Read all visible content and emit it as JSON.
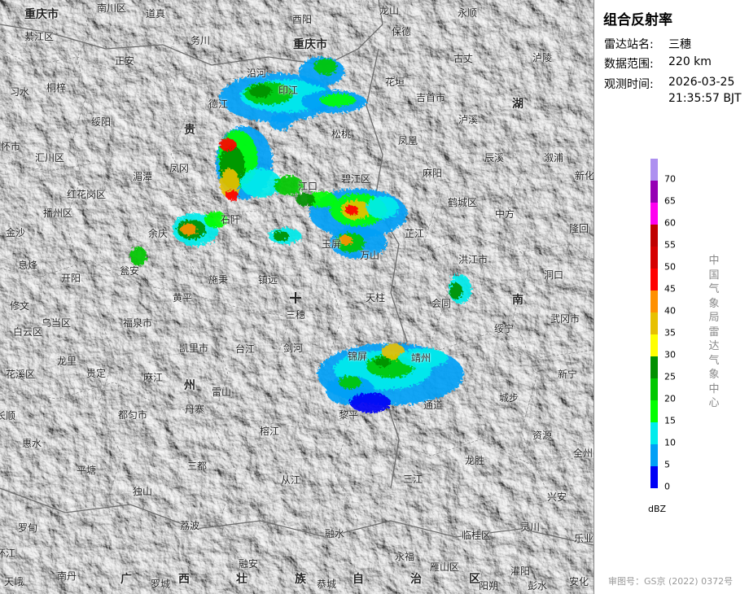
{
  "info": {
    "title": "组合反射率",
    "station_label": "雷达站名:",
    "station_value": "三穗",
    "range_label": "数据范围:",
    "range_value": "220 km",
    "time_label": "观测时间:",
    "time_date": "2026-03-25",
    "time_clock": "21:35:57 BJT"
  },
  "legend": {
    "unit": "dBZ",
    "ticks": [
      "0",
      "5",
      "10",
      "15",
      "20",
      "25",
      "30",
      "35",
      "40",
      "45",
      "50",
      "55",
      "60",
      "65",
      "70"
    ],
    "colors": [
      "#0000f6",
      "#01a0f6",
      "#00ecec",
      "#01ff00",
      "#00c800",
      "#019000",
      "#ffff00",
      "#e7c000",
      "#ff9000",
      "#ff0000",
      "#d60000",
      "#c00000",
      "#ff00f0",
      "#9600b4",
      "#ad90f0"
    ]
  },
  "org": "中国气象局雷达气象中心",
  "review": "审图号：GS京 (2022) 0372号",
  "regions": [
    {
      "t": "重庆市"
    },
    {
      "t": "重庆市"
    },
    {
      "t": "贵"
    },
    {
      "t": "州"
    },
    {
      "t": "湖"
    },
    {
      "t": "南"
    },
    {
      "t": "广"
    },
    {
      "t": "西"
    },
    {
      "t": "壮"
    },
    {
      "t": "族"
    },
    {
      "t": "自"
    },
    {
      "t": "治"
    },
    {
      "t": "区"
    }
  ],
  "places": [
    "南川区",
    "道真",
    "酉阳",
    "龙山",
    "永顺",
    "綦江区",
    "务川",
    "沿河",
    "保德",
    "古丈",
    "泸陵",
    "正安",
    "习水",
    "桐梓",
    "印江",
    "花垣",
    "吉首市",
    "绥阳",
    "德江",
    "泸溪",
    "松桃",
    "凤凰",
    "辰溪",
    "溆浦",
    "仁怀市",
    "汇川区",
    "湄潭",
    "凤冈",
    "江口",
    "碧江区",
    "麻阳",
    "鹤城区",
    "中方",
    "新化",
    "红花岗区",
    "播州区",
    "石阡",
    "芷江",
    "隆回",
    "金沙",
    "余庆",
    "玉屏",
    "万山",
    "洪江市",
    "息烽",
    "开阳",
    "瓮安",
    "施秉",
    "镇远",
    "天柱",
    "会同",
    "洞口",
    "修文",
    "黄平",
    "三穗",
    "武冈市",
    "乌当区",
    "白云区",
    "福泉市",
    "绥宁",
    "龙里",
    "凯里市",
    "台江",
    "剑河",
    "锦屏",
    "靖州",
    "新宁",
    "花溪区",
    "贵定",
    "麻江",
    "雷山",
    "黎平",
    "城步",
    "长顺",
    "都匀市",
    "丹寨",
    "通道",
    "资源",
    "惠水",
    "榕江",
    "全州",
    "平塘",
    "三都",
    "龙胜",
    "独山",
    "从江",
    "三江",
    "兴安",
    "罗甸",
    "荔波",
    "融水",
    "临桂区",
    "灵川",
    "环江",
    "融安",
    "永福",
    "雁山区",
    "灌阳",
    "乐业",
    "天峨",
    "南丹",
    "罗城",
    "恭城",
    "阳朔",
    "彭水",
    "安化",
    "秀山",
    "铜仁",
    "玉屏",
    "安顺",
    "开阳",
    "龙里",
    "三江",
    "溪",
    "九",
    "江",
    "流"
  ]
}
